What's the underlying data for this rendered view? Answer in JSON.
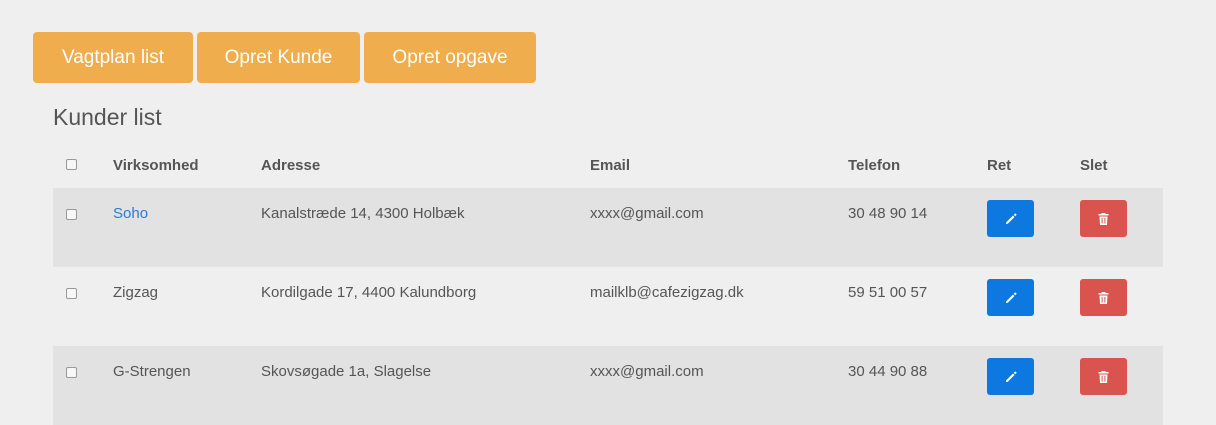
{
  "toolbar": {
    "vagtplan_label": "Vagtplan list",
    "opret_kunde_label": "Opret Kunde",
    "opret_opgave_label": "Opret opgave"
  },
  "page": {
    "title": "Kunder list"
  },
  "table": {
    "headers": {
      "company": "Virksomhed",
      "address": "Adresse",
      "email": "Email",
      "phone": "Telefon",
      "edit": "Ret",
      "delete": "Slet"
    },
    "rows": [
      {
        "company": "Soho",
        "address": "Kanalstræde 14, 4300 Holbæk",
        "email": "xxxx@gmail.com",
        "phone": "30 48 90 14"
      },
      {
        "company": "Zigzag",
        "address": "Kordilgade 17, 4400 Kalundborg",
        "email": "mailklb@cafezigzag.dk",
        "phone": "59 51 00 57"
      },
      {
        "company": "G-Strengen",
        "address": "Skovsøgade 1a, Slagelse",
        "email": "xxxx@gmail.com",
        "phone": "30 44 90 88"
      }
    ]
  },
  "colors": {
    "orange": "#f0ad4e",
    "edit_blue": "#0c78e0",
    "delete_red": "#d9534f",
    "link_blue": "#2a7bd6"
  },
  "icons": {
    "edit": "pencil-icon",
    "delete": "trash-icon"
  }
}
